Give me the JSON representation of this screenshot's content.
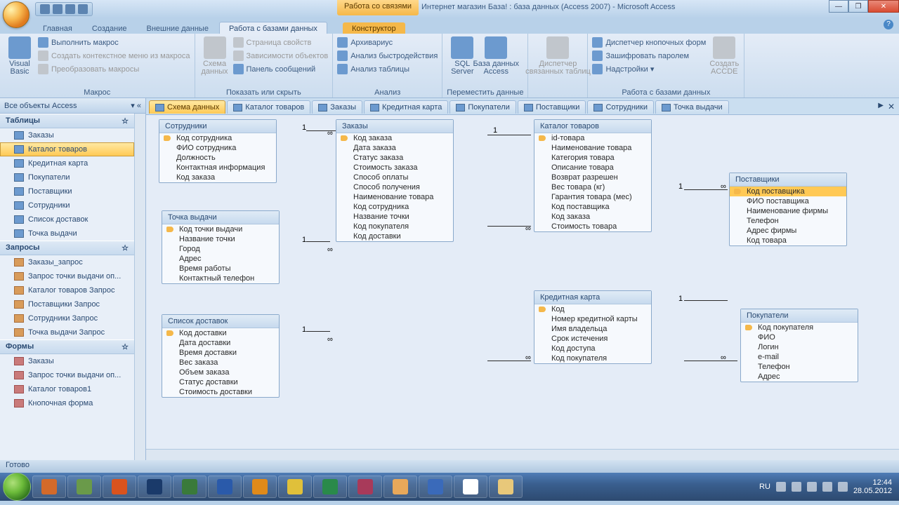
{
  "title": {
    "contextual": "Работа со связями",
    "text": "Интернет магазин База! : база данных (Access 2007) - Microsoft Access"
  },
  "tabs": {
    "items": [
      "Главная",
      "Создание",
      "Внешние данные",
      "Работа с базами данных"
    ],
    "ctx": "Конструктор",
    "active": 3
  },
  "ribbon": {
    "g0": {
      "label": "Макрос",
      "vb": "Visual\nBasic",
      "b0": "Выполнить макрос",
      "b1": "Создать контекстное меню из макроса",
      "b2": "Преобразовать макросы"
    },
    "g1": {
      "label": "Показать или скрыть",
      "big": "Схема\nданных",
      "b0": "Страница свойств",
      "b1": "Зависимости объектов",
      "b2": "Панель сообщений"
    },
    "g2": {
      "label": "Анализ",
      "b0": "Архивариус",
      "b1": "Анализ быстродействия",
      "b2": "Анализ таблицы"
    },
    "g3": {
      "label": "Переместить данные",
      "sql": "SQL\nServer",
      "acc": "База данных\nAccess"
    },
    "g4": {
      "label": "",
      "big": "Диспетчер\nсвязанных таблиц"
    },
    "g5": {
      "label": "Работа с базами данных",
      "b0": "Диспетчер кнопочных форм",
      "b1": "Зашифровать паролем",
      "b2": "Надстройки ▾",
      "accde": "Создать\nACCDE"
    }
  },
  "doctabs": {
    "items": [
      "Схема данных",
      "Каталог товаров",
      "Заказы",
      "Кредитная карта",
      "Покупатели",
      "Поставщики",
      "Сотрудники",
      "Точка выдачи"
    ],
    "active": 0
  },
  "nav": {
    "hdr": "Все объекты Access",
    "s0": {
      "title": "Таблицы",
      "items": [
        "Заказы",
        "Каталог товаров",
        "Кредитная карта",
        "Покупатели",
        "Поставщики",
        "Сотрудники",
        "Список доставок",
        "Точка выдачи"
      ],
      "sel": 1
    },
    "s1": {
      "title": "Запросы",
      "items": [
        "Заказы_запрос",
        "Запрос точки выдачи оп...",
        "Каталог товаров Запрос",
        "Поставщики Запрос",
        "Сотрудники Запрос",
        "Точка выдачи Запрос"
      ]
    },
    "s2": {
      "title": "Формы",
      "items": [
        "Заказы",
        "Запрос точки выдачи оп...",
        "Каталог товаров1",
        "Кнопочная форма"
      ]
    }
  },
  "tables": {
    "t0": {
      "title": "Сотрудники",
      "pk": [
        0
      ],
      "fields": [
        "Код сотрудника",
        "ФИО сотрудника",
        "Должность",
        "Контактная информация",
        "Код заказа"
      ]
    },
    "t1": {
      "title": "Точка выдачи",
      "pk": [
        0
      ],
      "fields": [
        "Код точки выдачи",
        "Название точки",
        "Город",
        "Адрес",
        "Время работы",
        "Контактный телефон"
      ]
    },
    "t2": {
      "title": "Список доставок",
      "pk": [
        0
      ],
      "fields": [
        "Код доставки",
        "Дата доставки",
        "Время доставки",
        "Вес заказа",
        "Объем заказа",
        "Статус доставки",
        "Стоимость доставки"
      ]
    },
    "t3": {
      "title": "Заказы",
      "pk": [
        0
      ],
      "fields": [
        "Код заказа",
        "Дата заказа",
        "Статус заказа",
        "Стоимость заказа",
        "Способ оплаты",
        "Способ получения",
        "Наименование товара",
        "Код сотрудника",
        "Название точки",
        "Код покупателя",
        "Код доставки"
      ]
    },
    "t4": {
      "title": "Каталог товаров",
      "pk": [
        0
      ],
      "fields": [
        "id-товара",
        "Наименование товара",
        "Категория товара",
        "Описание товара",
        "Возврат разрешен",
        "Вес товара (кг)",
        "Гарантия товара (мес)",
        "Код поставщика",
        "Код заказа",
        "Стоимость товара"
      ]
    },
    "t5": {
      "title": "Кредитная карта",
      "pk": [
        0
      ],
      "fields": [
        "Код",
        "Номер кредитной карты",
        "Имя владельца",
        "Срок истечения",
        "Код доступа",
        "Код покупателя"
      ]
    },
    "t6": {
      "title": "Поставщики",
      "pk": [
        0
      ],
      "sel": 0,
      "fields": [
        "Код поставщика",
        "ФИО поставщика",
        "Наименование фирмы",
        "Телефон",
        "Адрес фирмы",
        "Код товара"
      ]
    },
    "t7": {
      "title": "Покупатели",
      "pk": [
        0
      ],
      "fields": [
        "Код покупателя",
        "ФИО",
        "Логин",
        "e-mail",
        "Телефон",
        "Адрес"
      ]
    }
  },
  "status": "Готово",
  "tray": {
    "lang": "RU",
    "time": "12:44",
    "date": "28.05.2012"
  }
}
